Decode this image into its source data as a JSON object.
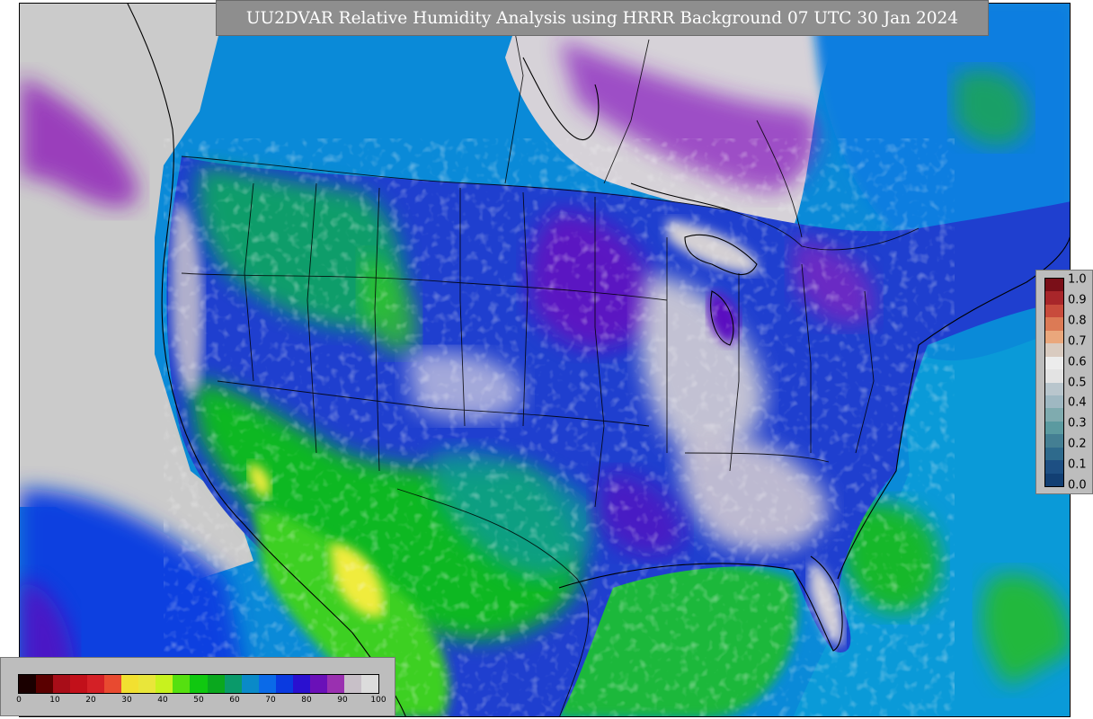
{
  "title": "UU2DVAR Relative Humidity Analysis using HRRR Background 07 UTC 30 Jan 2024",
  "observation_colorbar": {
    "ticks": [
      "1.0",
      "0.9",
      "0.8",
      "0.7",
      "0.6",
      "0.5",
      "0.4",
      "0.3",
      "0.2",
      "0.1",
      "0.0"
    ],
    "colors": [
      "#7a0f18",
      "#a8262a",
      "#c84b3c",
      "#dc7a55",
      "#eaa77c",
      "#d9cbc0",
      "#ececec",
      "#e3e3e3",
      "#b9c6cd",
      "#9fb8c2",
      "#7fabaf",
      "#5b9aa0",
      "#447f93",
      "#2e6a8c",
      "#1d4f83",
      "#123f73"
    ]
  },
  "rh_colorbar": {
    "ticks": [
      "0",
      "10",
      "20",
      "30",
      "40",
      "50",
      "60",
      "70",
      "80",
      "90",
      "100"
    ],
    "colors": [
      "#1a0000",
      "#5a0000",
      "#a80d18",
      "#c2101a",
      "#d42026",
      "#e84a30",
      "#f2e030",
      "#e9e63a",
      "#c8f21e",
      "#55e010",
      "#10c810",
      "#0aa81e",
      "#0a9a6a",
      "#0a8ac8",
      "#0a6ae8",
      "#0a3ae0",
      "#2a10d0",
      "#6a10b8",
      "#9a30b0",
      "#c8c0c8",
      "#dcdcdc"
    ]
  },
  "colors": {
    "land_base": "#1f3fcf",
    "ocean_base": "#0a88d8",
    "dry_green": "#10b820",
    "very_dry_yellow": "#f0ec3c",
    "saturated_purple": "#7a10b0",
    "saturated_gray": "#d4d0d4",
    "border_lines": "#000000"
  }
}
